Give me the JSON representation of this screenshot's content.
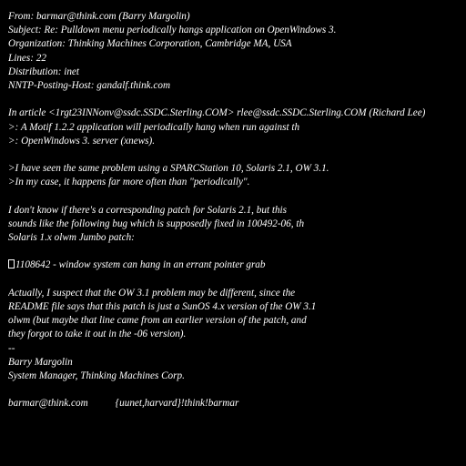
{
  "headers": {
    "from": "From: barmar@think.com (Barry Margolin)",
    "subject": "Subject: Re: Pulldown menu periodically hangs application on OpenWindows 3.",
    "organization": "Organization: Thinking Machines Corporation, Cambridge MA, USA",
    "lines": "Lines: 22",
    "distribution": "Distribution: inet",
    "nntp_host": "NNTP-Posting-Host: gandalf.think.com"
  },
  "quote": {
    "attribution": "In article <1rgt23INNonv@ssdc.SSDC.Sterling.COM> rlee@ssdc.SSDC.Sterling.COM (Richard Lee)",
    "lines": [
      ">: A Motif 1.2.2 application will periodically hang when run against th",
      ">: OpenWindows 3. server (xnews)."
    ]
  },
  "quote2": {
    "lines": [
      ">I have seen the same problem using a SPARCStation 10, Solaris 2.1, OW 3.1.",
      ">In my case, it happens far more often than \"periodically\"."
    ]
  },
  "body1": {
    "lines": [
      "I don't know if there's a corresponding patch for Solaris 2.1, but this",
      "sounds like the following bug which is supposedly fixed in 100492-06, th",
      "Solaris 1.x olwm Jumbo patch:"
    ]
  },
  "bug": {
    "text": "1108642 - window system can hang in an errant pointer grab"
  },
  "body2": {
    "lines": [
      "Actually, I suspect that the OW 3.1 problem may be different, since the",
      "README file says that this patch is just a SunOS 4.x version of the OW 3.1",
      "olwm (but maybe that line came from an earlier version of the patch, and",
      "they forgot to take it out in the -06 version)."
    ]
  },
  "signature": {
    "separator": "--",
    "name": "Barry Margolin",
    "title": "System Manager, Thinking Machines Corp.",
    "email": "barmar@think.com",
    "uucp": "{uunet,harvard}!think!barmar"
  }
}
